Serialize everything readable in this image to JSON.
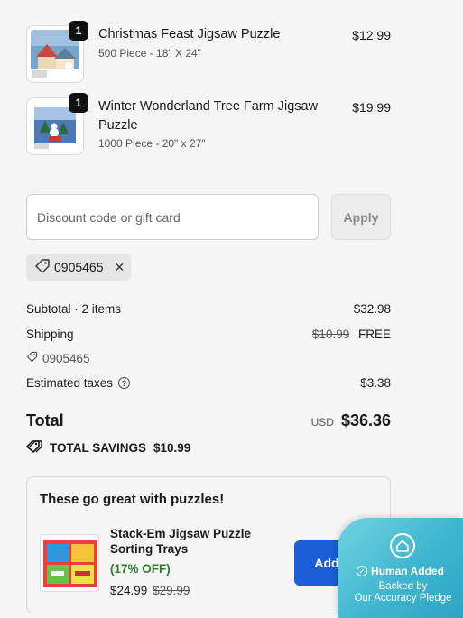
{
  "cart": {
    "items": [
      {
        "quantity": "1",
        "title": "Christmas Feast Jigsaw Puzzle",
        "subtitle": "500 Piece - 18\" X 24\"",
        "price": "$12.99",
        "image_icon": "puzzle-box-christmas-feast"
      },
      {
        "quantity": "1",
        "title": "Winter Wonderland Tree Farm Jigsaw Puzzle",
        "subtitle": "1000 Piece - 20\" x 27\"",
        "price": "$19.99",
        "image_icon": "puzzle-box-winter-wonderland"
      }
    ]
  },
  "discount": {
    "placeholder": "Discount code or gift card",
    "apply_label": "Apply",
    "applied_code": "0905465"
  },
  "summary": {
    "subtotal_label": "Subtotal · 2 items",
    "subtotal_value": "$32.98",
    "shipping_label": "Shipping",
    "shipping_original": "$10.99",
    "shipping_value": "FREE",
    "shipping_code": "0905465",
    "taxes_label": "Estimated taxes",
    "taxes_value": "$3.38",
    "total_label": "Total",
    "currency": "USD",
    "total_value": "$36.36",
    "savings_label": "TOTAL SAVINGS",
    "savings_value": "$10.99"
  },
  "upsell": {
    "heading": "These go great with puzzles!",
    "product_name": "Stack-Em Jigsaw Puzzle Sorting Trays",
    "discount_text": "(17% OFF)",
    "price": "$24.99",
    "original_price": "$29.99",
    "add_label": "Add"
  },
  "badge": {
    "title": "Human Added",
    "subtitle_line1": "Backed by",
    "subtitle_line2": "Our Accuracy Pledge"
  },
  "colors": {
    "background": "#f5f5f5",
    "add_button": "#1a5fd8",
    "savings_green": "#2e7d32",
    "badge": "#3fb6cf"
  }
}
